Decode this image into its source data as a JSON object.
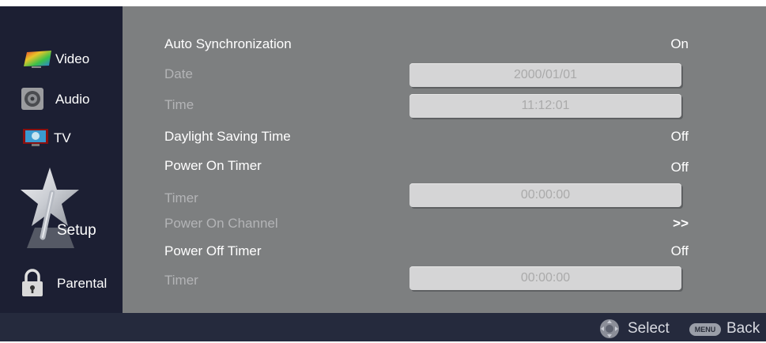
{
  "sidebar": {
    "items": [
      {
        "label": "Video",
        "icon": "video-icon"
      },
      {
        "label": "Audio",
        "icon": "audio-speaker-icon"
      },
      {
        "label": "TV",
        "icon": "tv-icon"
      },
      {
        "label": "Setup",
        "icon": "setup-star-icon"
      },
      {
        "label": "Parental",
        "icon": "padlock-icon"
      }
    ],
    "selected": "Setup"
  },
  "settings": {
    "rows": [
      {
        "label": "Auto Synchronization",
        "value": "On",
        "enabled": true
      },
      {
        "label": "Date",
        "value": "2000/01/01",
        "enabled": false
      },
      {
        "label": "Time",
        "value": "11:12:01",
        "enabled": false
      },
      {
        "label": "Daylight Saving Time",
        "value": "Off",
        "enabled": true
      },
      {
        "label": "Power On Timer",
        "value": "Off",
        "enabled": true
      },
      {
        "label": "Timer",
        "value": "00:00:00",
        "enabled": false
      },
      {
        "label": "Power On Channel",
        "value": ">>",
        "enabled": false
      },
      {
        "label": "Power Off Timer",
        "value": "Off",
        "enabled": true
      },
      {
        "label": "Timer",
        "value": "00:00:00",
        "enabled": false
      }
    ]
  },
  "footer": {
    "select_label": "Select",
    "menu_key": "MENU",
    "back_label": "Back"
  },
  "colors": {
    "sidebar_bg": "#1c1f33",
    "panel_bg": "#7d7f80",
    "footer_bg": "#252a3d",
    "text_active": "#ffffff",
    "text_disabled": "#b3b4b6",
    "field_bg": "#d5d5d6"
  }
}
